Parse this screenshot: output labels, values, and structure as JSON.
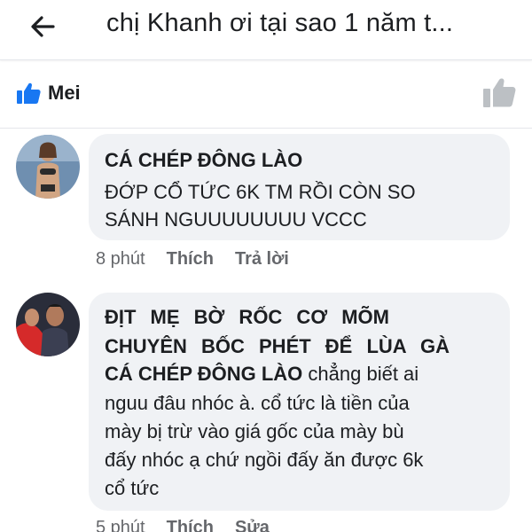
{
  "header": {
    "title": "chị Khanh ơi tại sao 1 năm t..."
  },
  "reactions": {
    "reactor_name": "Mei"
  },
  "comments": [
    {
      "author": "CÁ CHÉP ĐÔNG LÀO",
      "text_line1": "ĐỚP CỔ TỨC 6K TM RỒI CÒN SO",
      "text_line2": "SÁNH NGUUUUUUUU VCCC",
      "time": "8 phút",
      "like_label": "Thích",
      "reply_label": "Trả lời"
    },
    {
      "author_line1": "ĐỊT MẸ BỜ RỐC CƠ MÕM",
      "author_line2": "CHUYÊN BỐC PHÉT ĐỂ LÙA GÀ",
      "mention": "CÁ CHÉP ĐÔNG LÀO",
      "text_after_mention": "chẳng biết ai",
      "text_line2": "nguu đâu nhóc à. cổ tức là tiền của",
      "text_line3": "mày bị trừ vào giá gốc của mày bù",
      "text_line4": "đấy nhóc ạ chứ ngồi đấy ăn được 6k",
      "text_line5": "cổ tức",
      "time": "5 phút",
      "like_label": "Thích",
      "edit_label": "Sửa"
    }
  ],
  "colors": {
    "like_blue": "#1877f2",
    "like_gray": "#bcc0c4",
    "bubble": "#f0f2f5",
    "meta": "#65676b"
  }
}
